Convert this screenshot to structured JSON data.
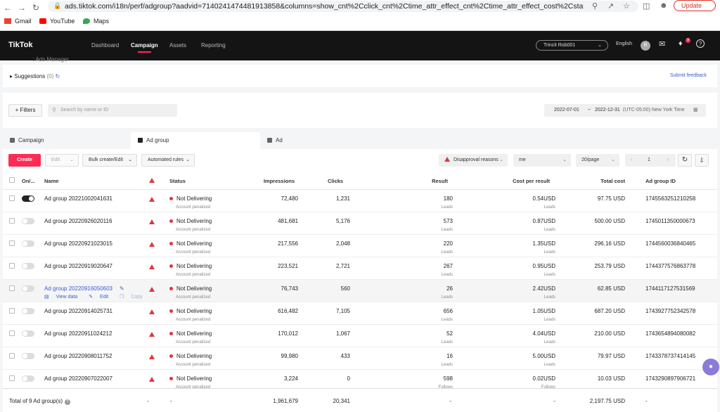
{
  "browser": {
    "url": "ads.tiktok.com/i18n/perf/adgroup?aadvid=7140241474481913858&columns=show_cnt%2Cclick_cnt%2Ctime_attr_effect_cnt%2Ctime_attr_effect_cost%2Cstat_cost%2...",
    "update_label": "Update",
    "bookmarks": [
      "Gmail",
      "YouTube",
      "Maps"
    ]
  },
  "header": {
    "logo": "TikTok",
    "logo_sub": ": Ads Manager",
    "nav": [
      "Dashboard",
      "Campaign",
      "Assets",
      "Reporting"
    ],
    "account": "Trincit Rob001",
    "language": "English",
    "avatar_initial": "R",
    "notif_count": "9"
  },
  "suggestions": {
    "title": "Suggestions",
    "count": "(0)",
    "feedback": "Submit feedback"
  },
  "filterbar": {
    "filters_label": "+ Filters",
    "search_placeholder": "Search by name or ID",
    "date_start": "2022-07-01",
    "date_sep": "~",
    "date_end": "2022-12-31",
    "timezone": "(UTC-05:00) New York Time"
  },
  "tabs": [
    "Campaign",
    "Ad group",
    "Ad"
  ],
  "toolbar": {
    "create": "Create",
    "edit": "Edit",
    "bulk": "Bulk create/Edit",
    "automated": "Automated rules",
    "disapproval": "Disapproval reasons",
    "me": "me",
    "per_page": "20/page",
    "page": "1"
  },
  "table": {
    "headers": {
      "onoff": "On/...",
      "name": "Name",
      "status": "Status",
      "impressions": "Impressions",
      "clicks": "Clicks",
      "result": "Result",
      "cpr": "Cost per result",
      "total_cost": "Total cost",
      "adgroup_id": "Ad group ID"
    },
    "row_actions": {
      "view": "View data",
      "edit": "Edit",
      "copy": "Copy",
      "more": "···"
    },
    "rows": [
      {
        "name": "Ad group 20221002041631",
        "status": "Not Delivering",
        "status_sub": "Account penalized",
        "impressions": "72,480",
        "clicks": "1,231",
        "result": "180",
        "result_sub": "Leads",
        "cpr": "0.54USD",
        "cpr_sub": "Leads",
        "total_cost": "97.75 USD",
        "id": "1745563251210258"
      },
      {
        "name": "Ad group 20220926020116",
        "status": "Not Delivering",
        "status_sub": "Account penalized",
        "impressions": "481,681",
        "clicks": "5,176",
        "result": "573",
        "result_sub": "Leads",
        "cpr": "0.87USD",
        "cpr_sub": "Leads",
        "total_cost": "500.00 USD",
        "id": "1745011350000673"
      },
      {
        "name": "Ad group 20220921023015",
        "status": "Not Delivering",
        "status_sub": "Account penalized",
        "impressions": "217,556",
        "clicks": "2,048",
        "result": "220",
        "result_sub": "Leads",
        "cpr": "1.35USD",
        "cpr_sub": "Leads",
        "total_cost": "296.16 USD",
        "id": "1744560036840465"
      },
      {
        "name": "Ad group 20220919020647",
        "status": "Not Delivering",
        "status_sub": "Account penalized",
        "impressions": "223,521",
        "clicks": "2,721",
        "result": "267",
        "result_sub": "Leads",
        "cpr": "0.95USD",
        "cpr_sub": "Leads",
        "total_cost": "253.79 USD",
        "id": "1744377576863778"
      },
      {
        "name": "Ad group 20220916050603",
        "status": "Not Delivering",
        "status_sub": "Account penalized",
        "impressions": "76,743",
        "clicks": "560",
        "result": "26",
        "result_sub": "Leads",
        "cpr": "2.42USD",
        "cpr_sub": "Leads",
        "total_cost": "62.85 USD",
        "id": "1744117127531569"
      },
      {
        "name": "Ad group 20220914025731",
        "status": "Not Delivering",
        "status_sub": "Account penalized",
        "impressions": "616,482",
        "clicks": "7,105",
        "result": "656",
        "result_sub": "Leads",
        "cpr": "1.05USD",
        "cpr_sub": "Leads",
        "total_cost": "687.20 USD",
        "id": "1743927752342578"
      },
      {
        "name": "Ad group 20220911024212",
        "status": "Not Delivering",
        "status_sub": "Account penalized",
        "impressions": "170,012",
        "clicks": "1,067",
        "result": "52",
        "result_sub": "Leads",
        "cpr": "4.04USD",
        "cpr_sub": "Leads",
        "total_cost": "210.00 USD",
        "id": "1743654894080082"
      },
      {
        "name": "Ad group 20220908011752",
        "status": "Not Delivering",
        "status_sub": "Account penalized",
        "impressions": "99,980",
        "clicks": "433",
        "result": "16",
        "result_sub": "Leads",
        "cpr": "5.00USD",
        "cpr_sub": "Leads",
        "total_cost": "79.97 USD",
        "id": "1743378737414145"
      },
      {
        "name": "Ad group 20220907022007",
        "status": "Not Delivering",
        "status_sub": "Account penalized",
        "impressions": "3,224",
        "clicks": "0",
        "result": "598",
        "result_sub": "Follows",
        "cpr": "0.02USD",
        "cpr_sub": "Follows",
        "total_cost": "10.03 USD",
        "id": "1743290897906721"
      }
    ],
    "total": {
      "label": "Total of 9 Ad group(s)",
      "dash": "-",
      "impressions": "1,961,679",
      "clicks": "20,341",
      "result": "-",
      "cpr": "-",
      "total_cost": "2,197.75 USD",
      "id": "-"
    }
  },
  "colors": {
    "accent": "#fe2c55",
    "link": "#3b5ccf",
    "warn": "#e0353d"
  }
}
